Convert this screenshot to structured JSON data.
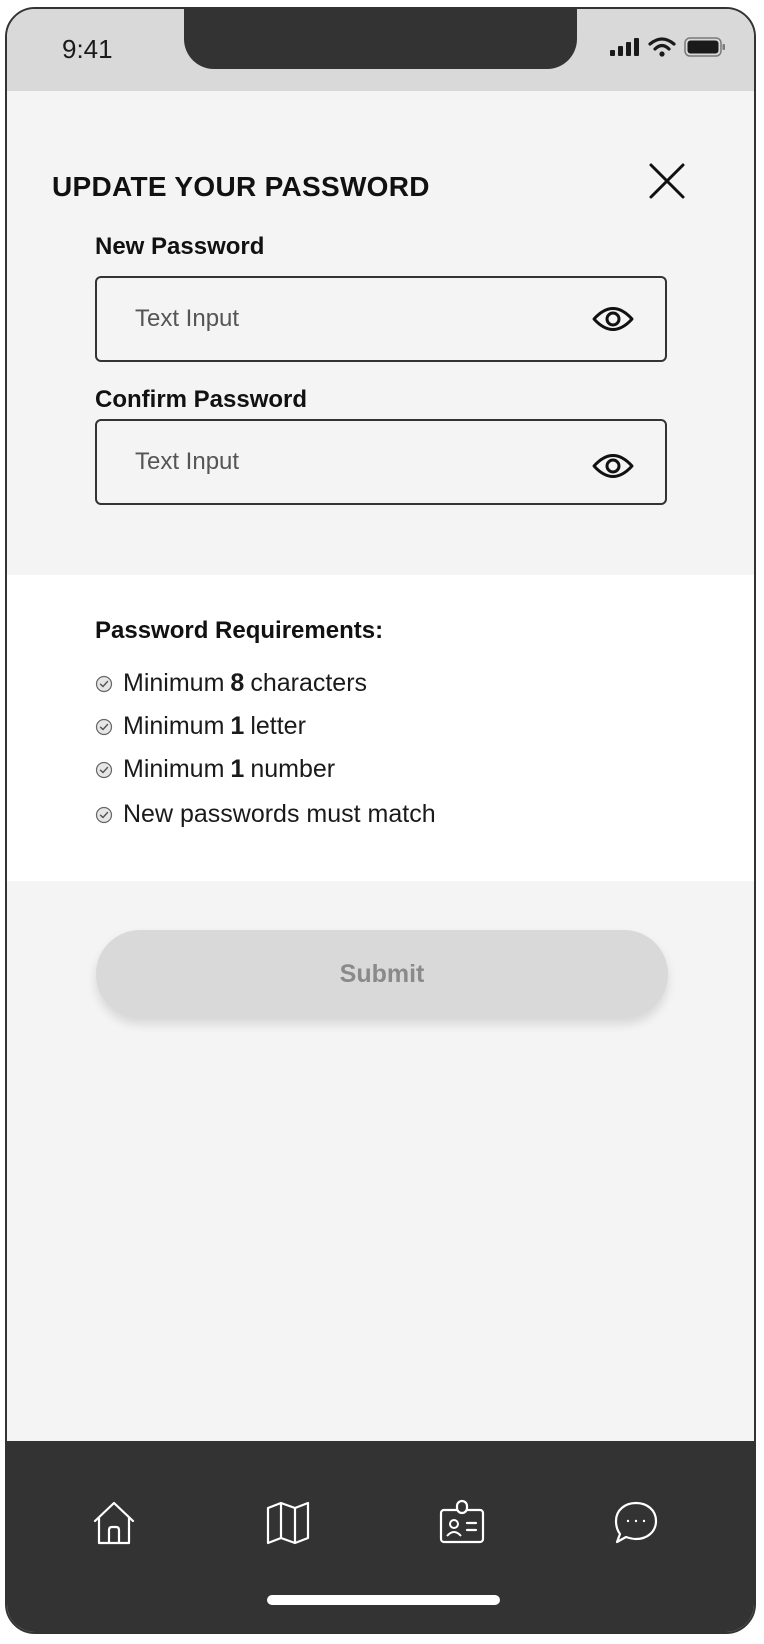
{
  "status_bar": {
    "time": "9:41"
  },
  "header": {
    "title": "UPDATE YOUR PASSWORD"
  },
  "form": {
    "new_password": {
      "label": "New Password",
      "placeholder": "Text Input"
    },
    "confirm_password": {
      "label": "Confirm Password",
      "placeholder": "Text Input"
    }
  },
  "requirements": {
    "title": "Password Requirements:",
    "items": [
      {
        "prefix": "Minimum",
        "bold": "8",
        "suffix": "characters"
      },
      {
        "prefix": "Minimum",
        "bold": "1",
        "suffix": "letter"
      },
      {
        "prefix": "Minimum",
        "bold": "1",
        "suffix": "number"
      },
      {
        "prefix": "New passwords must match",
        "bold": "",
        "suffix": ""
      }
    ]
  },
  "submit": {
    "label": "Submit"
  },
  "tab_bar": {
    "icons": [
      "home-icon",
      "map-icon",
      "id-card-icon",
      "chat-icon"
    ]
  },
  "colors": {
    "dark": "#333333",
    "surface": "#f4f4f4",
    "disabled_button": "#d9d9d9",
    "disabled_text": "#8a8a8a"
  }
}
